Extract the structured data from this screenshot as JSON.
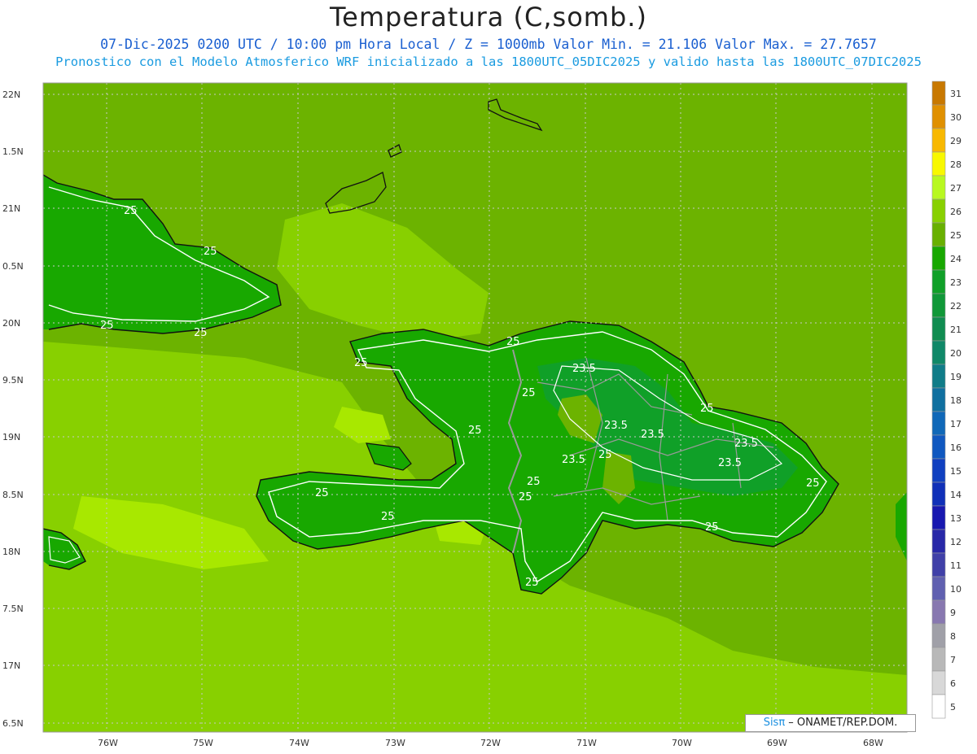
{
  "header": {
    "title": "Temperatura (C,somb.)",
    "line1": "07-Dic-2025 0200 UTC / 10:00 pm Hora Local / Z = 1000mb   Valor Min. = 21.106  Valor Max. = 27.7657",
    "line2": "Pronostico con el Modelo Atmosferico WRF inicializado a las 1800UTC_05DIC2025 y valido hasta las  1800UTC_07DIC2025"
  },
  "axes": {
    "lat_labels": [
      "22N",
      "1.5N",
      "21N",
      "0.5N",
      "20N",
      "9.5N",
      "19N",
      "8.5N",
      "18N",
      "7.5N",
      "17N",
      "6.5N"
    ],
    "lon_labels": [
      "76W",
      "75W",
      "74W",
      "73W",
      "72W",
      "71W",
      "70W",
      "69W",
      "68W"
    ]
  },
  "colorbar": {
    "labels": [
      "31",
      "30",
      "29",
      "28",
      "27",
      "26",
      "25",
      "24",
      "23",
      "22",
      "21",
      "20",
      "19",
      "18",
      "17",
      "16",
      "15",
      "14",
      "13",
      "12",
      "11",
      "10",
      "9",
      "8",
      "7",
      "6",
      "5"
    ],
    "colors": [
      "#c87800",
      "#e09000",
      "#f8b800",
      "#f8f800",
      "#b8f820",
      "#88d000",
      "#68b000",
      "#18a800",
      "#10a028",
      "#109838",
      "#108c50",
      "#108868",
      "#107c88",
      "#1070a0",
      "#1068b8",
      "#1058c0",
      "#1040c0",
      "#1030b8",
      "#1818b0",
      "#2828a8",
      "#4040a8",
      "#6060b0",
      "#8878b0",
      "#a0a0a8",
      "#b8b8b8",
      "#d8d8d8",
      "#ffffff"
    ]
  },
  "contour_labels": [
    "25",
    "25",
    "25",
    "25",
    "25",
    "25",
    "23.5",
    "25",
    "25",
    "23.5",
    "23.5",
    "23.5",
    "23.5",
    "25",
    "25",
    "25",
    "25",
    "25",
    "23.5",
    "25",
    "25",
    "25",
    "25"
  ],
  "credit": {
    "brand": "SisPi",
    "brand_symbol": "Sisπ",
    "text": " – ONAMET/REP.DOM."
  }
}
